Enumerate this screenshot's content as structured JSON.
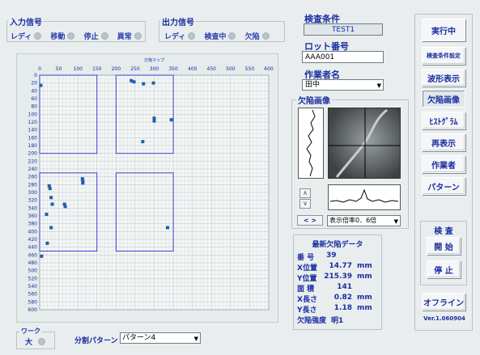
{
  "input_signal": {
    "title": "入力信号",
    "items": [
      {
        "label": "レディ"
      },
      {
        "label": "移動"
      },
      {
        "label": "停止"
      },
      {
        "label": "異常"
      }
    ]
  },
  "output_signal": {
    "title": "出力信号",
    "items": [
      {
        "label": "レディ"
      },
      {
        "label": "検査中"
      },
      {
        "label": "欠陥"
      }
    ]
  },
  "inspection": {
    "condition_label": "検査条件",
    "condition_value": "TEST1",
    "lot_label": "ロット番号",
    "lot_value": "AAA001",
    "operator_label": "作業者名",
    "operator_value": "田中"
  },
  "defect_map": {
    "title": "欠陥マップ",
    "x_ticks": [
      "0",
      "50",
      "100",
      "150",
      "200",
      "250",
      "300",
      "350",
      "400",
      "450",
      "500",
      "550",
      "600"
    ],
    "y_ticks": [
      "0",
      "20",
      "40",
      "60",
      "80",
      "100",
      "120",
      "140",
      "160",
      "180",
      "200",
      "220",
      "240",
      "260",
      "280",
      "300",
      "320",
      "340",
      "360",
      "380",
      "400",
      "420",
      "440",
      "460",
      "480",
      "500",
      "520",
      "540",
      "560",
      "580",
      "600"
    ],
    "xlim": [
      0,
      600
    ],
    "ylim": [
      0,
      600
    ],
    "regions": [
      {
        "x0": 0,
        "y0": 0,
        "x1": 150,
        "y1": 200
      },
      {
        "x0": 200,
        "y0": 0,
        "x1": 350,
        "y1": 200
      },
      {
        "x0": 0,
        "y0": 250,
        "x1": 150,
        "y1": 450
      },
      {
        "x0": 200,
        "y0": 250,
        "x1": 350,
        "y1": 450
      }
    ],
    "points": [
      {
        "x": 3,
        "y": 26
      },
      {
        "x": 240,
        "y": 14
      },
      {
        "x": 247,
        "y": 17
      },
      {
        "x": 272,
        "y": 22
      },
      {
        "x": 298,
        "y": 20
      },
      {
        "x": 300,
        "y": 110
      },
      {
        "x": 300,
        "y": 117
      },
      {
        "x": 345,
        "y": 114
      },
      {
        "x": 270,
        "y": 170
      },
      {
        "x": 25,
        "y": 283
      },
      {
        "x": 27,
        "y": 290
      },
      {
        "x": 30,
        "y": 313
      },
      {
        "x": 33,
        "y": 330
      },
      {
        "x": 65,
        "y": 330
      },
      {
        "x": 67,
        "y": 336
      },
      {
        "x": 18,
        "y": 356
      },
      {
        "x": 30,
        "y": 390
      },
      {
        "x": 20,
        "y": 430
      },
      {
        "x": 5,
        "y": 463
      },
      {
        "x": 112,
        "y": 265
      },
      {
        "x": 113,
        "y": 271
      },
      {
        "x": 113,
        "y": 276
      },
      {
        "x": 335,
        "y": 390
      }
    ]
  },
  "defect_image": {
    "title": "欠陥画像",
    "scale_label": "表示倍率0．6倍",
    "up_arrow": "∧",
    "down_arrow": "∨",
    "lr_label": "< >"
  },
  "latest_defect": {
    "title": "最新欠陥データ",
    "rows": [
      {
        "key": "番 号",
        "value": "39",
        "unit": ""
      },
      {
        "key": "X位置",
        "value": "14.77",
        "unit": "mm"
      },
      {
        "key": "Y位置",
        "value": "215.39",
        "unit": "mm"
      },
      {
        "key": "面 積",
        "value": "141",
        "unit": ""
      },
      {
        "key": "X長さ",
        "value": "0.82",
        "unit": "mm"
      },
      {
        "key": "Y長さ",
        "value": "1.18",
        "unit": "mm"
      },
      {
        "key": "欠陥強度",
        "value": "明1",
        "unit": ""
      }
    ]
  },
  "sidebar": {
    "status": "実行中",
    "buttons": [
      "検査条件設定",
      "波形表示",
      "欠陥画像",
      "ﾋｽﾄｸﾞﾗﾑ",
      "再表示",
      "作業者",
      "パターン"
    ],
    "inspection_title": "検 査",
    "start": "開 始",
    "stop": "停 止",
    "offline": "オフライン",
    "version": "Ver.1.060904"
  },
  "work": {
    "title": "ワーク",
    "value": "大"
  },
  "split_pattern": {
    "label": "分割パターン",
    "value": "パターン4"
  }
}
